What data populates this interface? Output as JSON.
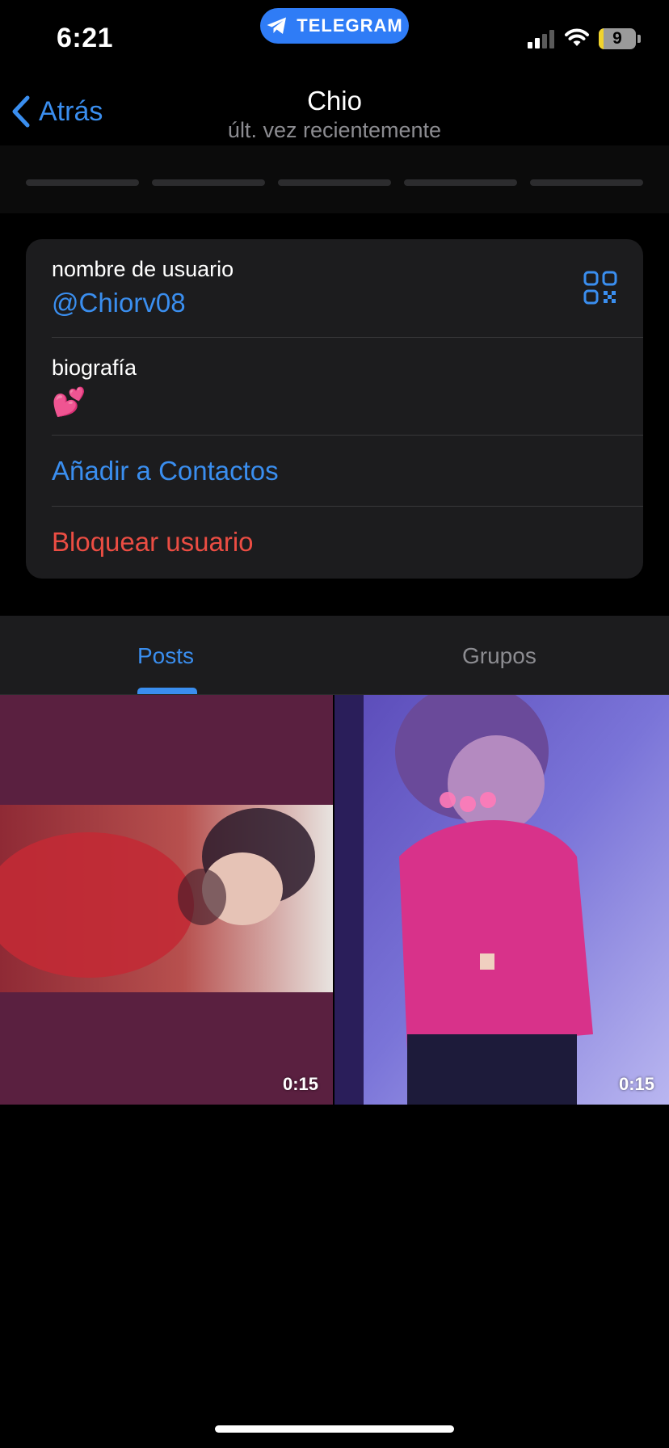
{
  "status_bar": {
    "time": "6:21",
    "app_pill": "TELEGRAM",
    "battery_level": "9",
    "battery_color": "#f1d32c",
    "signal_bars_active": 2,
    "signal_bars_total": 4
  },
  "nav": {
    "back_label": "Atrás",
    "title": "Chio",
    "subtitle": "últ. vez recientemente"
  },
  "stories": {
    "count": 5
  },
  "profile_info": {
    "username_label": "nombre de usuario",
    "username_value": "@Chiorv08",
    "bio_label": "biografía",
    "bio_value": "💕",
    "add_contact": "Añadir a Contactos",
    "block_user": "Bloquear usuario"
  },
  "tabs": [
    {
      "label": "Posts",
      "active": true
    },
    {
      "label": "Grupos",
      "active": false
    }
  ],
  "media": [
    {
      "duration": "0:15",
      "kind": "video"
    },
    {
      "duration": "0:15",
      "kind": "video"
    }
  ],
  "colors": {
    "accent": "#3a8eef",
    "danger": "#eb4d43",
    "card": "#1c1c1e",
    "telegram_pill": "#2f7cf6"
  }
}
